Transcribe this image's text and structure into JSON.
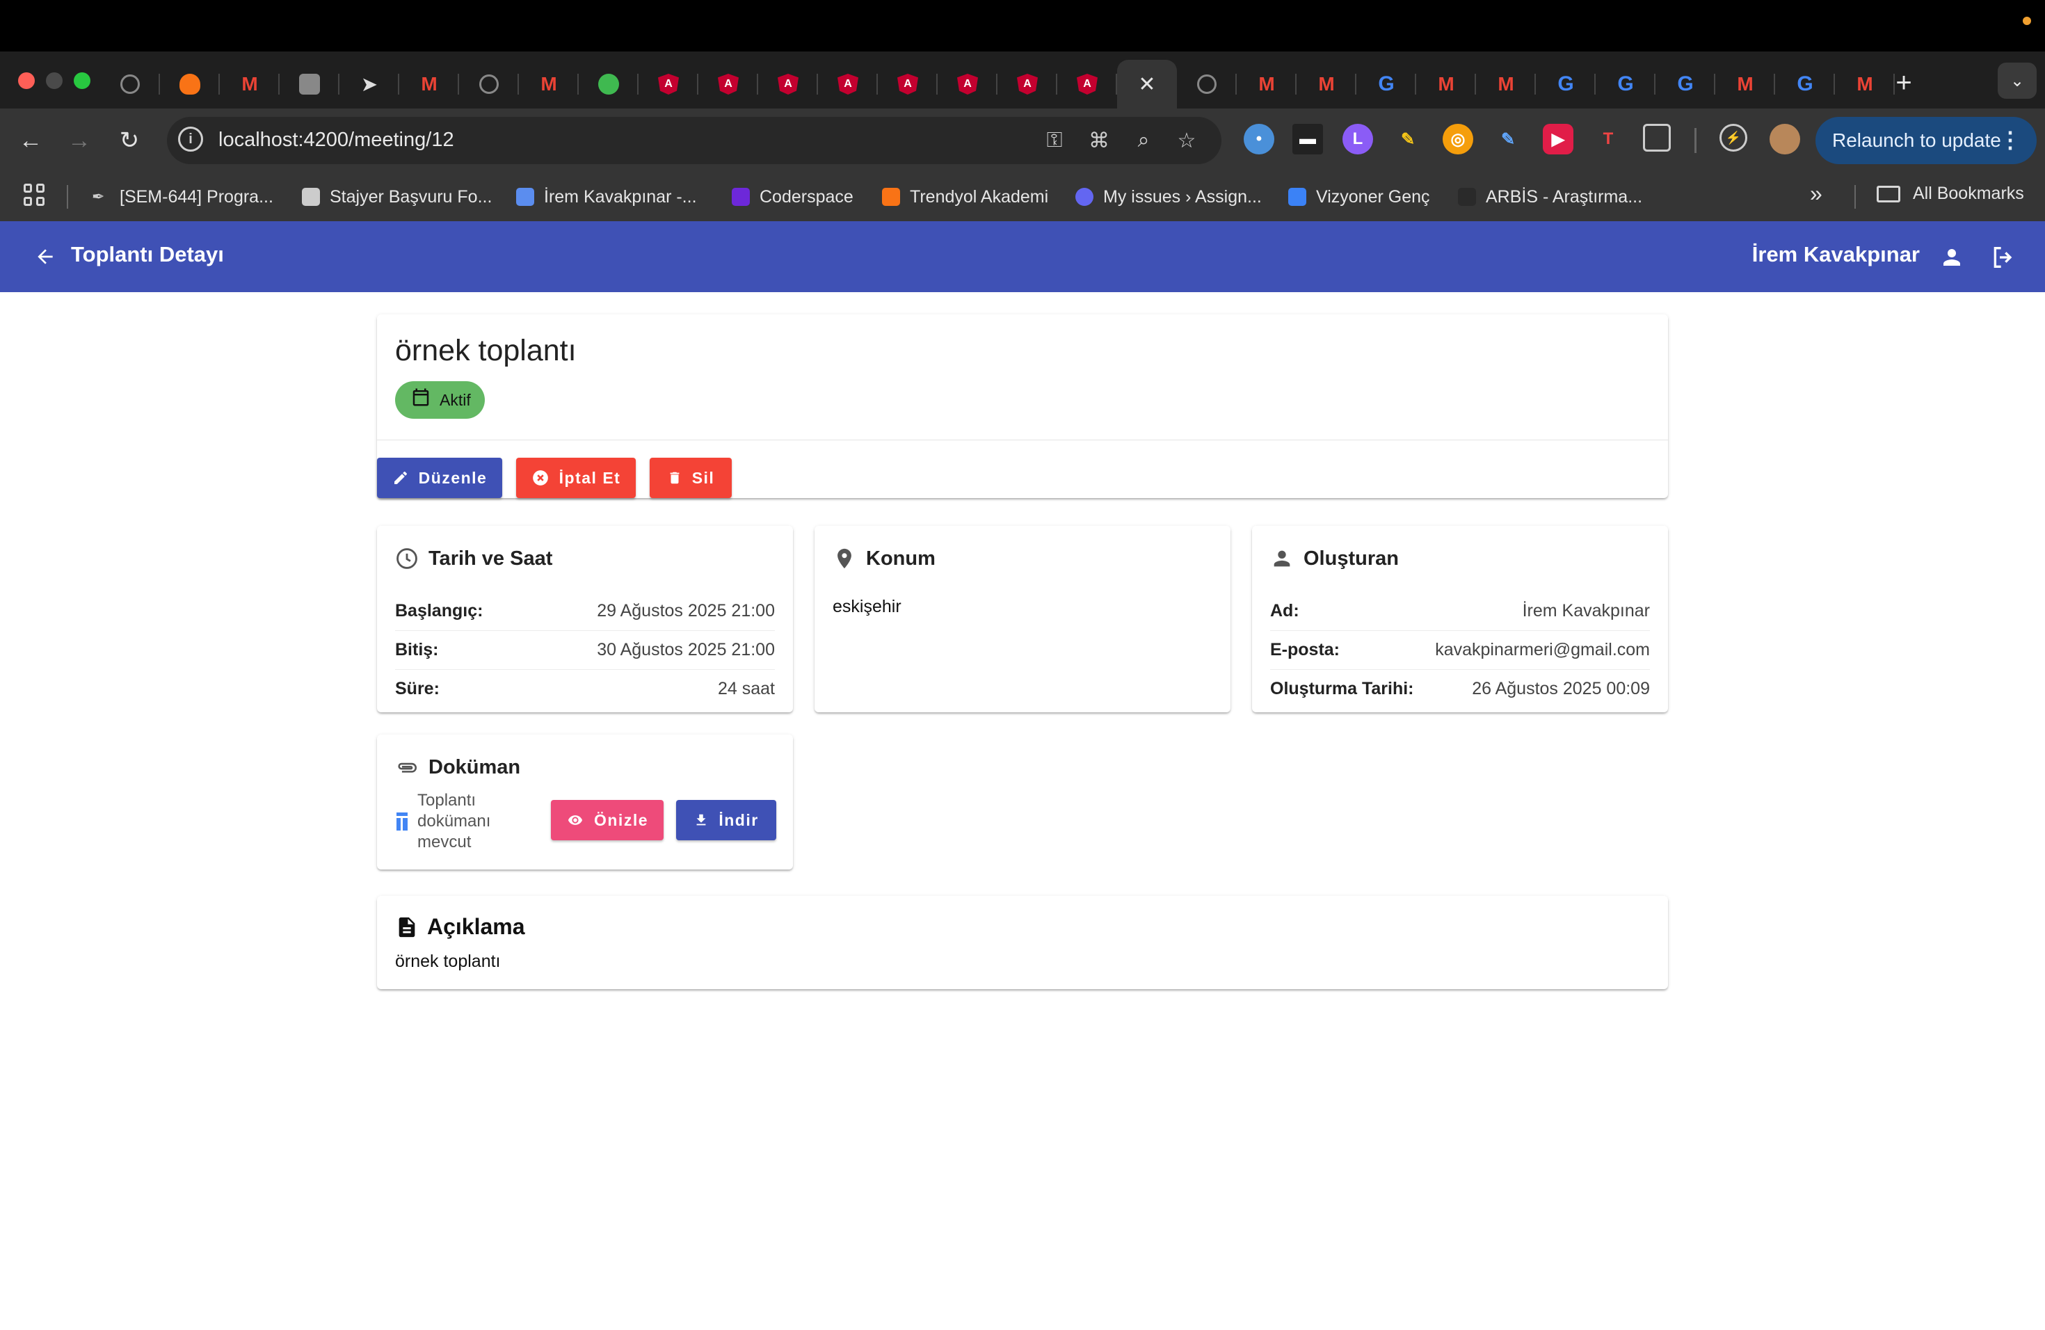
{
  "browser": {
    "tabs": [
      {
        "icon": "openai-icon"
      },
      {
        "icon": "fire-icon"
      },
      {
        "icon": "gmail-icon"
      },
      {
        "icon": "robot-icon"
      },
      {
        "icon": "paper-plane-icon"
      },
      {
        "icon": "gmail-icon"
      },
      {
        "icon": "openai-icon"
      },
      {
        "icon": "gmail-icon"
      },
      {
        "icon": "globe-icon"
      },
      {
        "icon": "angular-icon"
      },
      {
        "icon": "angular-icon"
      },
      {
        "icon": "angular-icon"
      },
      {
        "icon": "angular-icon"
      },
      {
        "icon": "angular-icon"
      },
      {
        "icon": "angular-icon"
      },
      {
        "icon": "angular-icon"
      },
      {
        "icon": "angular-icon"
      },
      {
        "icon": "close-icon",
        "active": true
      },
      {
        "icon": "openai-icon"
      },
      {
        "icon": "gmail-icon"
      },
      {
        "icon": "gmail-icon"
      },
      {
        "icon": "google-icon"
      },
      {
        "icon": "gmail-icon"
      },
      {
        "icon": "gmail-icon"
      },
      {
        "icon": "google-icon"
      },
      {
        "icon": "google-icon"
      },
      {
        "icon": "google-icon"
      },
      {
        "icon": "gmail-icon"
      },
      {
        "icon": "google-chrome-icon"
      },
      {
        "icon": "gmail-icon"
      }
    ],
    "url": "localhost:4200/meeting/12",
    "relaunch_label": "Relaunch to update",
    "bookmarks": [
      {
        "label": "[SEM-644] Progra..."
      },
      {
        "label": "Stajyer Başvuru Fo..."
      },
      {
        "label": "İrem Kavakpınar -..."
      },
      {
        "label": "Coderspace"
      },
      {
        "label": "Trendyol Akademi"
      },
      {
        "label": "My issues › Assign..."
      },
      {
        "label": "Vizyoner Genç"
      },
      {
        "label": "ARBİS - Araştırma..."
      }
    ],
    "all_bookmarks_label": "All Bookmarks"
  },
  "appbar": {
    "title": "Toplantı Detayı",
    "user_name": "İrem Kavakpınar"
  },
  "meeting": {
    "title": "örnek toplantı",
    "status": "Aktif",
    "actions": {
      "edit": "Düzenle",
      "cancel": "İptal Et",
      "delete": "Sil"
    }
  },
  "datetime_card": {
    "heading": "Tarih ve Saat",
    "rows": [
      {
        "label": "Başlangıç:",
        "value": "29 Ağustos 2025 21:00"
      },
      {
        "label": "Bitiş:",
        "value": "30 Ağustos 2025 21:00"
      },
      {
        "label": "Süre:",
        "value": "24 saat"
      }
    ]
  },
  "location_card": {
    "heading": "Konum",
    "value": "eskişehir"
  },
  "creator_card": {
    "heading": "Oluşturan",
    "rows": [
      {
        "label": "Ad:",
        "value": "İrem Kavakpınar"
      },
      {
        "label": "E-posta:",
        "value": "kavakpinarmeri@gmail.com"
      },
      {
        "label": "Oluşturma Tarihi:",
        "value": "26 Ağustos 2025 00:09"
      }
    ]
  },
  "document_card": {
    "heading": "Doküman",
    "file_text": "Toplantı dokümanı mevcut",
    "preview": "Önizle",
    "download": "İndir"
  },
  "description_card": {
    "heading": "Açıklama",
    "text": "örnek toplantı"
  },
  "colors": {
    "primary": "#3f51b5",
    "warn": "#f44336",
    "accent": "#ee4b7a",
    "status_active": "#63b863"
  }
}
